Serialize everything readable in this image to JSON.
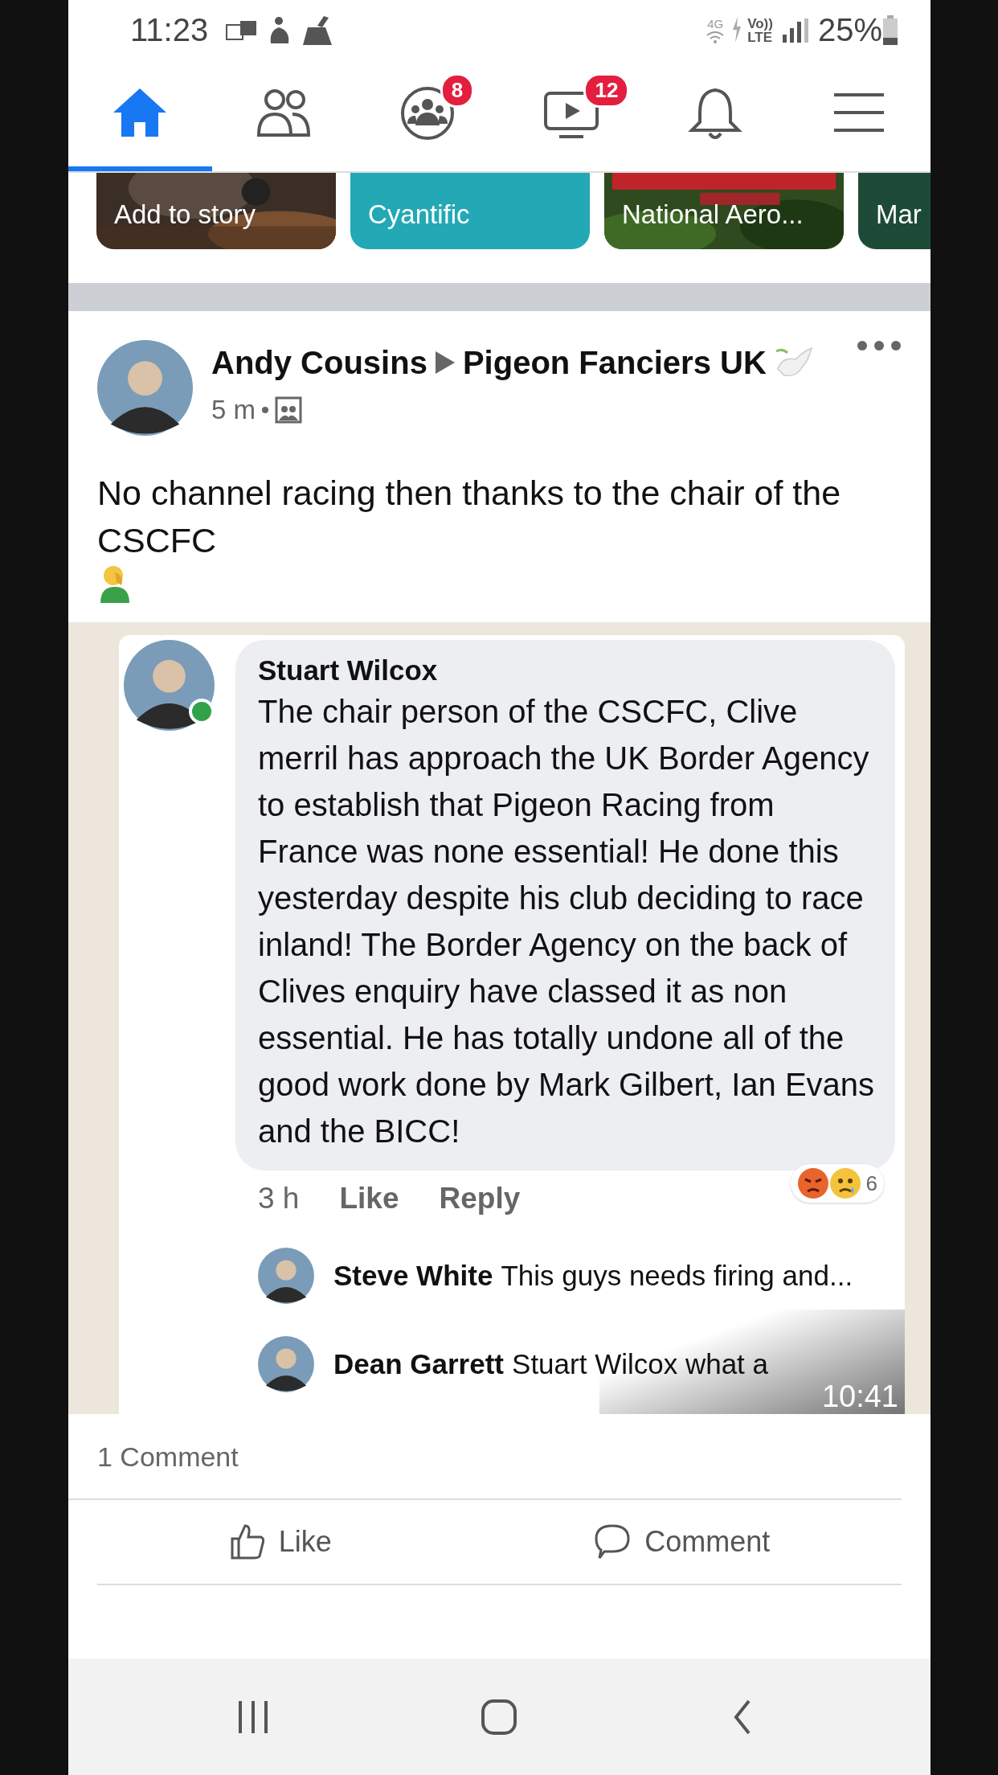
{
  "status_bar": {
    "time": "11:23",
    "network": "4G",
    "volte_top": "Vo))",
    "volte_bottom": "LTE",
    "battery": "25%"
  },
  "nav_tabs": [
    {
      "kind": "home",
      "selected": true
    },
    {
      "kind": "friends",
      "selected": false
    },
    {
      "kind": "groups",
      "selected": false,
      "badge": "8"
    },
    {
      "kind": "watch",
      "selected": false,
      "badge": "12"
    },
    {
      "kind": "bell",
      "selected": false
    },
    {
      "kind": "menu",
      "selected": false
    }
  ],
  "stories": [
    {
      "label": "Add to story",
      "kind": "picture"
    },
    {
      "label": "Cyantific",
      "kind": "color",
      "color": "#22a9b5"
    },
    {
      "label": "National Aero...",
      "kind": "picture"
    },
    {
      "label": "Mar",
      "kind": "color",
      "color": "#1d4a36"
    }
  ],
  "post": {
    "author": "Andy Cousins",
    "group": "Pigeon Fanciers UK",
    "time": "5 m",
    "text": "No channel racing then thanks to the chair of the CSCFC",
    "shared_screenshot": {
      "comment": {
        "author": "Stuart Wilcox",
        "online": true,
        "text": "The chair person of the CSCFC, Clive merril has approach the UK Border Agency to establish that Pigeon Racing from France was none essential! He done this yesterday despite his club deciding to race inland! The Border Agency on the back of Clives enquiry have classed it as non essential. He has totally undone all of the good work done by Mark Gilbert, Ian Evans and the BICC!",
        "time": "3 h",
        "like": "Like",
        "reply": "Reply",
        "reaction_count": "6"
      },
      "replies": [
        {
          "author": "Steve White",
          "text": "This guys needs firing and..."
        },
        {
          "author": "Dean Garrett",
          "text": "Stuart Wilcox what a"
        }
      ],
      "video_time": "10:41"
    },
    "comment_count": "1 Comment",
    "actions": [
      {
        "kind": "like",
        "label": "Like"
      },
      {
        "kind": "comment",
        "label": "Comment"
      }
    ]
  },
  "system_nav": [
    {
      "kind": "recents"
    },
    {
      "kind": "home"
    },
    {
      "kind": "back"
    }
  ]
}
